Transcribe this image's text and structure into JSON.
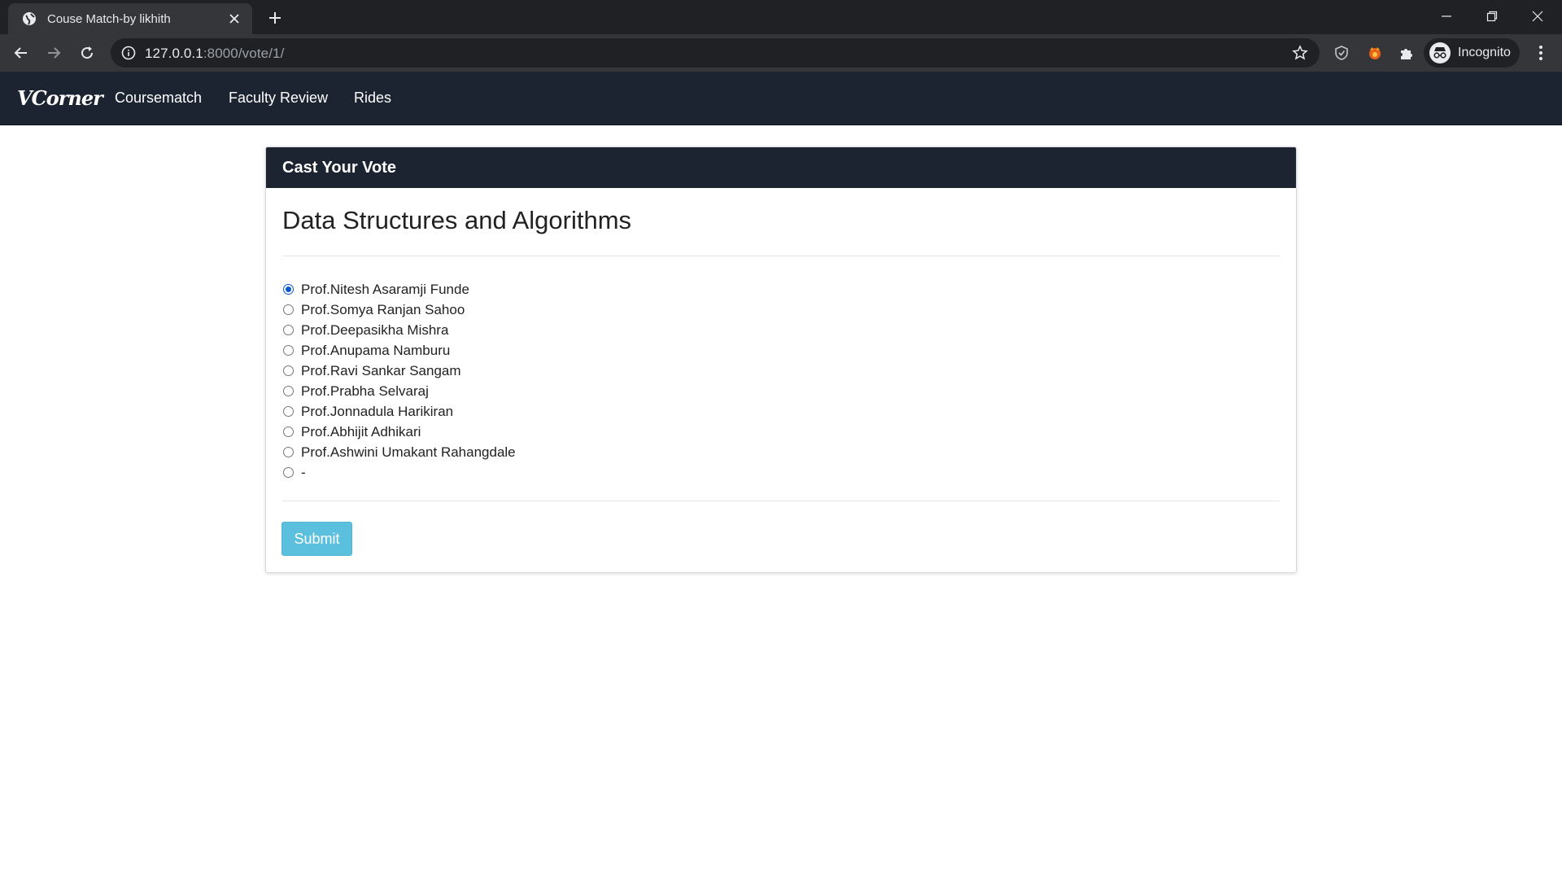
{
  "browser": {
    "tab_title": "Couse Match-by likhith",
    "url_host": "127.0.0.1",
    "url_rest": ":8000/vote/1/",
    "profile_label": "Incognito"
  },
  "site_nav": {
    "brand": "VCorner",
    "links": [
      "Coursematch",
      "Faculty Review",
      "Rides"
    ]
  },
  "vote_card": {
    "header": "Cast Your Vote",
    "course": "Data Structures and Algorithms",
    "options": [
      {
        "label": "Prof.Nitesh Asaramji Funde",
        "checked": true
      },
      {
        "label": "Prof.Somya Ranjan Sahoo",
        "checked": false
      },
      {
        "label": "Prof.Deepasikha Mishra",
        "checked": false
      },
      {
        "label": "Prof.Anupama Namburu",
        "checked": false
      },
      {
        "label": "Prof.Ravi Sankar Sangam",
        "checked": false
      },
      {
        "label": "Prof.Prabha Selvaraj",
        "checked": false
      },
      {
        "label": "Prof.Jonnadula Harikiran",
        "checked": false
      },
      {
        "label": "Prof.Abhijit Adhikari",
        "checked": false
      },
      {
        "label": "Prof.Ashwini Umakant Rahangdale",
        "checked": false
      },
      {
        "label": "-",
        "checked": false
      }
    ],
    "submit_label": "Submit"
  },
  "colors": {
    "navbar": "#1c2331",
    "submit": "#5bc0de",
    "radio_checked": "#0b57d0"
  }
}
